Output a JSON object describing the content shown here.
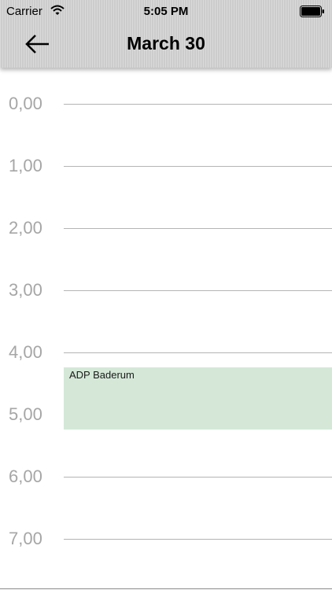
{
  "status_bar": {
    "carrier": "Carrier",
    "time": "5:05 PM",
    "wifi_icon": "wifi-icon",
    "battery_icon": "battery-icon"
  },
  "nav": {
    "title": "March 30",
    "back_icon": "arrow-left-icon"
  },
  "day_view": {
    "hours": [
      "0,00",
      "1,00",
      "2,00",
      "3,00",
      "4,00",
      "5,00",
      "6,00",
      "7,00"
    ],
    "events": [
      {
        "title": "ADP Baderum",
        "color": "#d5e8d8"
      }
    ]
  },
  "colors": {
    "nav_background": "#d3d3d3",
    "hour_label": "#a6a6a6",
    "hour_line": "#b4b4b4",
    "event_background": "#d5e8d8"
  }
}
